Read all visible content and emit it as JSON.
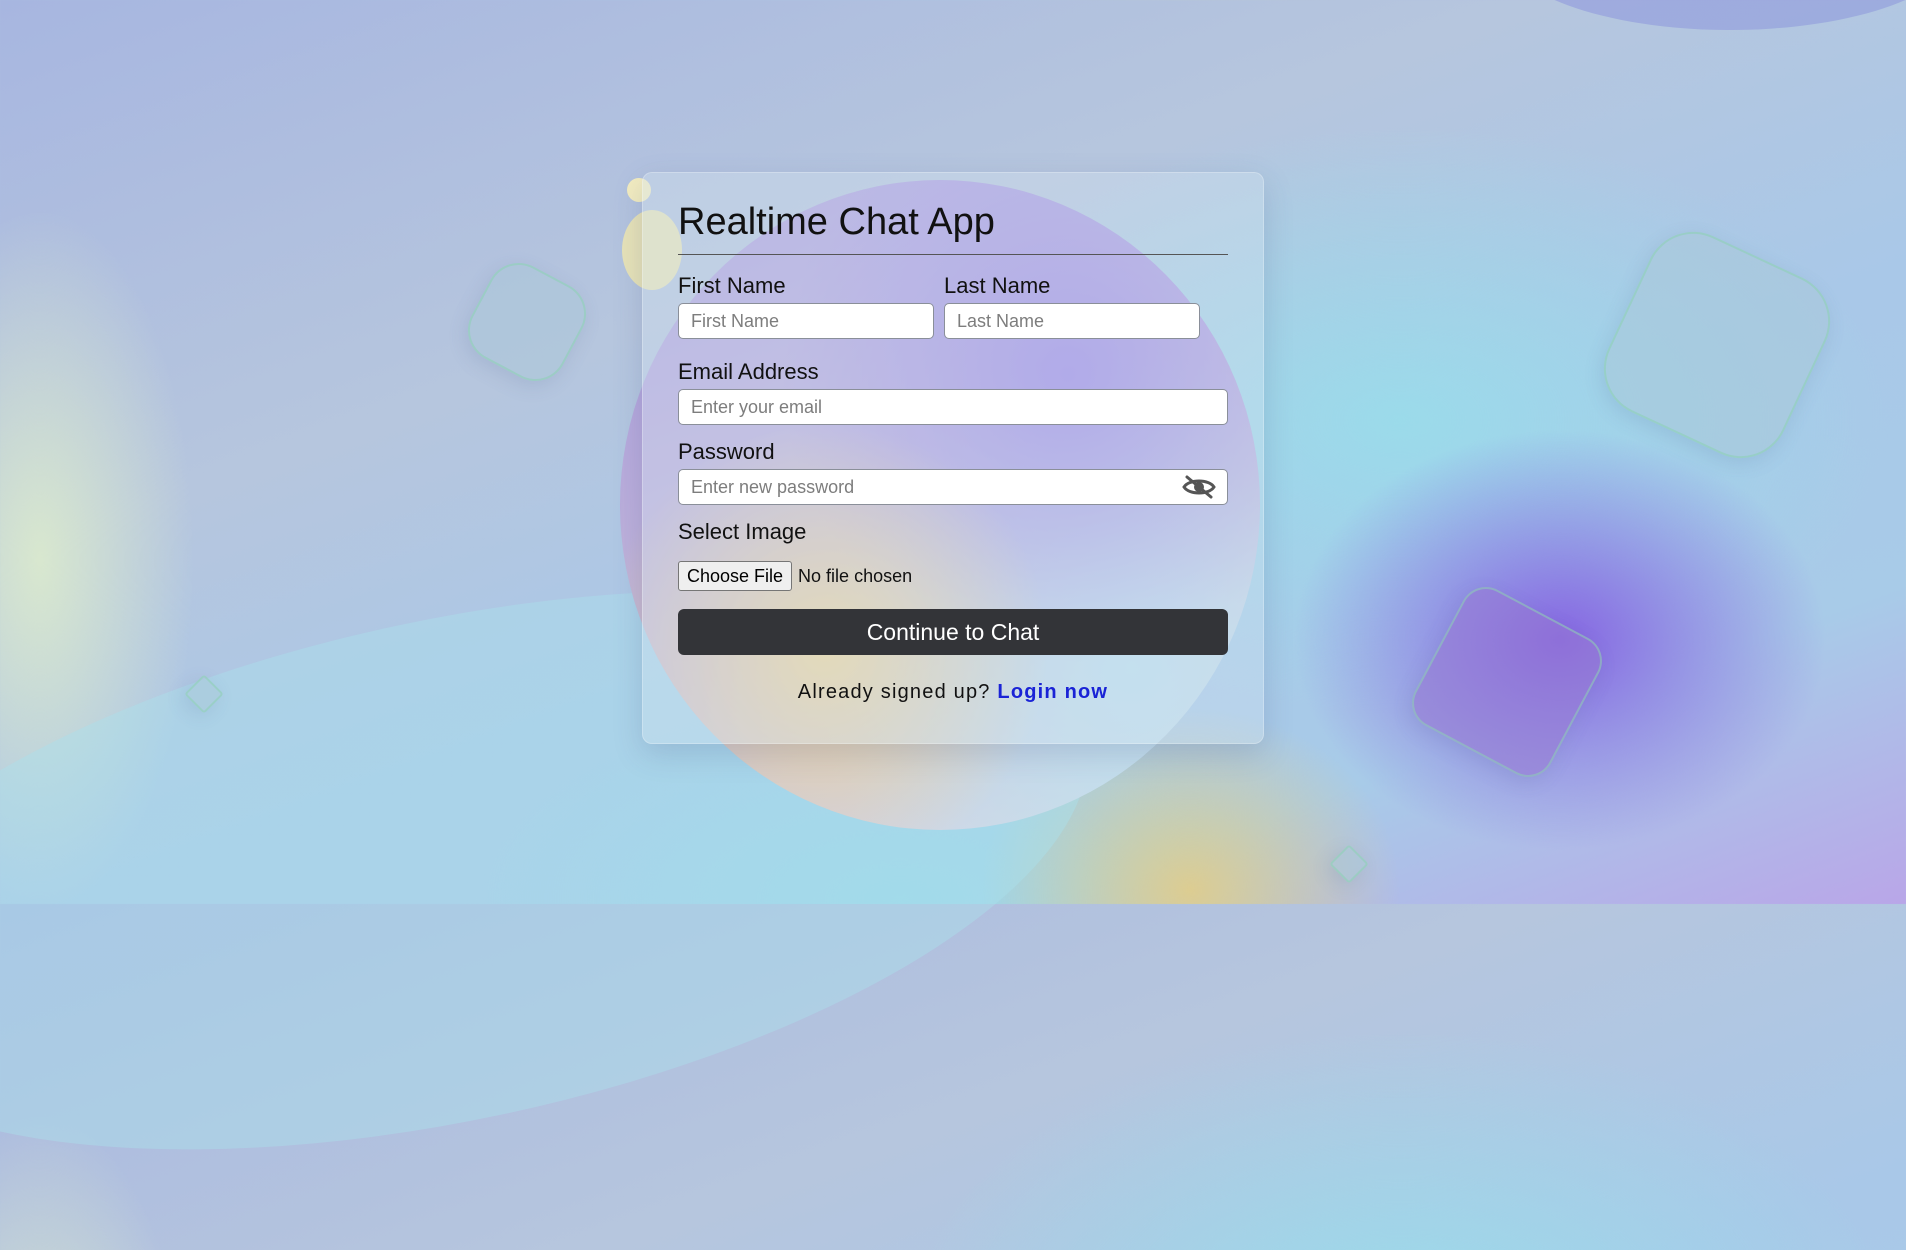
{
  "app": {
    "title": "Realtime Chat App"
  },
  "form": {
    "first_name": {
      "label": "First Name",
      "placeholder": "First Name",
      "value": ""
    },
    "last_name": {
      "label": "Last Name",
      "placeholder": "Last Name",
      "value": ""
    },
    "email": {
      "label": "Email Address",
      "placeholder": "Enter your email",
      "value": ""
    },
    "password": {
      "label": "Password",
      "placeholder": "Enter new password",
      "value": "",
      "toggle_icon": "eye-slash-icon"
    },
    "image": {
      "label": "Select Image",
      "button_label": "Choose File",
      "status": "No file chosen"
    },
    "submit_label": "Continue to Chat"
  },
  "footer": {
    "prompt": "Already signed up?",
    "link_label": "Login now"
  },
  "colors": {
    "button_bg": "#333438",
    "link": "#1a23d6"
  }
}
